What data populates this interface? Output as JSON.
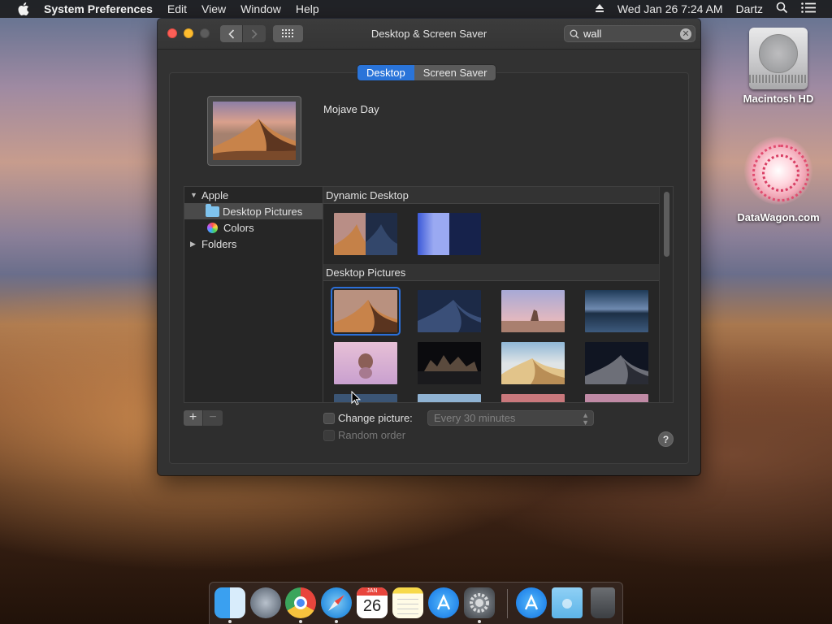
{
  "menubar": {
    "app_name": "System Preferences",
    "menus": [
      "Edit",
      "View",
      "Window",
      "Help"
    ],
    "datetime": "Wed Jan 26  7:24 AM",
    "user": "Dartz"
  },
  "desktop_icons": [
    {
      "label": "Macintosh HD",
      "icon": "hard-drive-icon"
    },
    {
      "label": "DataWagon.com",
      "icon": "datawagon-logo-icon"
    }
  ],
  "window": {
    "title": "Desktop & Screen Saver",
    "search_value": "wall",
    "tabs": [
      {
        "label": "Desktop",
        "active": true
      },
      {
        "label": "Screen Saver",
        "active": false
      }
    ],
    "current_picture_name": "Mojave Day",
    "source_list": {
      "apple_label": "Apple",
      "desktop_pictures_label": "Desktop Pictures",
      "colors_label": "Colors",
      "folders_label": "Folders"
    },
    "sections": {
      "dynamic": "Dynamic Desktop",
      "pictures": "Desktop Pictures"
    },
    "change_picture_label": "Change picture:",
    "interval_value": "Every 30 minutes",
    "random_order_label": "Random order",
    "add_label": "+",
    "remove_label": "−",
    "help_label": "?"
  },
  "colors": {
    "accent": "#2a74d9",
    "close": "#fd5f57",
    "minimize": "#febc2e"
  },
  "dock": {
    "calendar_day": "26",
    "calendar_month": "JAN",
    "apps": [
      "Finder",
      "Launchpad",
      "Google Chrome",
      "Safari",
      "Calendar",
      "Notes",
      "App Store",
      "System Preferences",
      "App Store",
      "Downloads",
      "Trash"
    ]
  }
}
